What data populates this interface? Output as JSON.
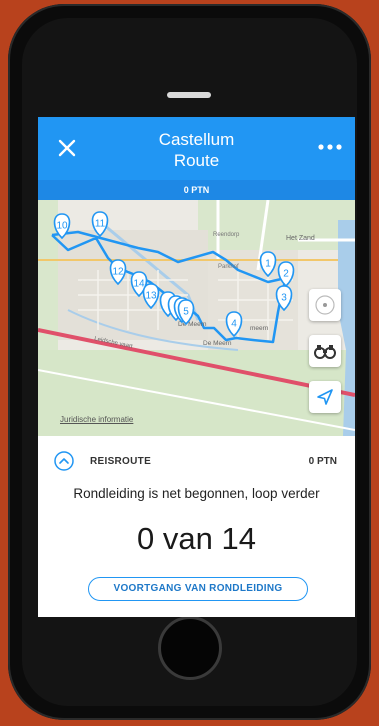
{
  "header": {
    "title_line1": "Castellum",
    "title_line2": "Route",
    "points_bar": "0 PTN"
  },
  "map": {
    "labels": {
      "het_zand": "Het Zand",
      "de_meern_1": "De Meern",
      "de_meern_2": "De Meern",
      "meern": "meern",
      "de_meern_3": "De Meern",
      "vaart": "Leidsche vaart",
      "veenendaal": "Reendorp",
      "parkhof": "Parkhof"
    },
    "legal_link": "Juridische informatie",
    "markers": [
      "1",
      "2",
      "3",
      "4",
      "5",
      "10",
      "11",
      "12",
      "13",
      "14"
    ]
  },
  "panel": {
    "route_label": "REISROUTE",
    "route_points": "0 PTN",
    "status": "Rondleiding is net begonnen, loop verder",
    "progress": "0 van 14",
    "progress_button": "VOORTGANG VAN RONDLEIDING"
  },
  "colors": {
    "accent": "#2196f3",
    "points_bar": "#1e88e5",
    "background": "#b8421d"
  },
  "icons": [
    "close-icon",
    "more-icon",
    "compass-icon",
    "binoculars-icon",
    "location-arrow-icon",
    "chevron-up-icon"
  ]
}
